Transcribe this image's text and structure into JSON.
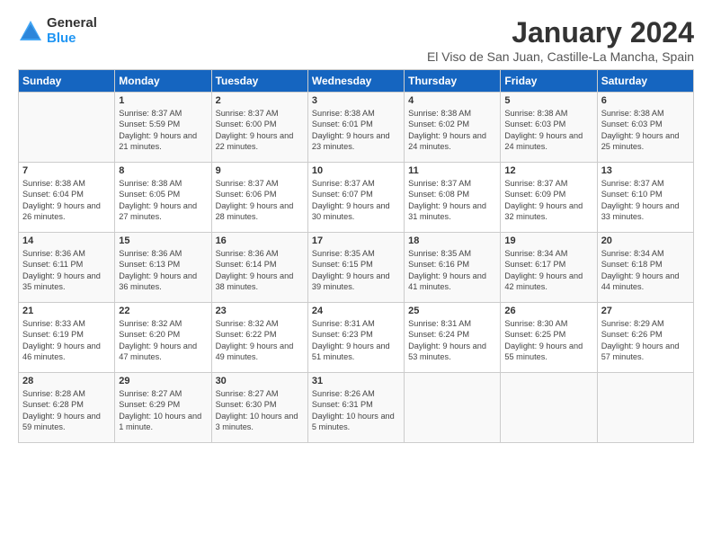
{
  "logo": {
    "general": "General",
    "blue": "Blue"
  },
  "title": "January 2024",
  "location": "El Viso de San Juan, Castille-La Mancha, Spain",
  "headers": [
    "Sunday",
    "Monday",
    "Tuesday",
    "Wednesday",
    "Thursday",
    "Friday",
    "Saturday"
  ],
  "weeks": [
    [
      {
        "day": "",
        "content": ""
      },
      {
        "day": "1",
        "content": "Sunrise: 8:37 AM\nSunset: 5:59 PM\nDaylight: 9 hours\nand 21 minutes."
      },
      {
        "day": "2",
        "content": "Sunrise: 8:37 AM\nSunset: 6:00 PM\nDaylight: 9 hours\nand 22 minutes."
      },
      {
        "day": "3",
        "content": "Sunrise: 8:38 AM\nSunset: 6:01 PM\nDaylight: 9 hours\nand 23 minutes."
      },
      {
        "day": "4",
        "content": "Sunrise: 8:38 AM\nSunset: 6:02 PM\nDaylight: 9 hours\nand 24 minutes."
      },
      {
        "day": "5",
        "content": "Sunrise: 8:38 AM\nSunset: 6:03 PM\nDaylight: 9 hours\nand 24 minutes."
      },
      {
        "day": "6",
        "content": "Sunrise: 8:38 AM\nSunset: 6:03 PM\nDaylight: 9 hours\nand 25 minutes."
      }
    ],
    [
      {
        "day": "7",
        "content": "Sunrise: 8:38 AM\nSunset: 6:04 PM\nDaylight: 9 hours\nand 26 minutes."
      },
      {
        "day": "8",
        "content": "Sunrise: 8:38 AM\nSunset: 6:05 PM\nDaylight: 9 hours\nand 27 minutes."
      },
      {
        "day": "9",
        "content": "Sunrise: 8:37 AM\nSunset: 6:06 PM\nDaylight: 9 hours\nand 28 minutes."
      },
      {
        "day": "10",
        "content": "Sunrise: 8:37 AM\nSunset: 6:07 PM\nDaylight: 9 hours\nand 30 minutes."
      },
      {
        "day": "11",
        "content": "Sunrise: 8:37 AM\nSunset: 6:08 PM\nDaylight: 9 hours\nand 31 minutes."
      },
      {
        "day": "12",
        "content": "Sunrise: 8:37 AM\nSunset: 6:09 PM\nDaylight: 9 hours\nand 32 minutes."
      },
      {
        "day": "13",
        "content": "Sunrise: 8:37 AM\nSunset: 6:10 PM\nDaylight: 9 hours\nand 33 minutes."
      }
    ],
    [
      {
        "day": "14",
        "content": "Sunrise: 8:36 AM\nSunset: 6:11 PM\nDaylight: 9 hours\nand 35 minutes."
      },
      {
        "day": "15",
        "content": "Sunrise: 8:36 AM\nSunset: 6:13 PM\nDaylight: 9 hours\nand 36 minutes."
      },
      {
        "day": "16",
        "content": "Sunrise: 8:36 AM\nSunset: 6:14 PM\nDaylight: 9 hours\nand 38 minutes."
      },
      {
        "day": "17",
        "content": "Sunrise: 8:35 AM\nSunset: 6:15 PM\nDaylight: 9 hours\nand 39 minutes."
      },
      {
        "day": "18",
        "content": "Sunrise: 8:35 AM\nSunset: 6:16 PM\nDaylight: 9 hours\nand 41 minutes."
      },
      {
        "day": "19",
        "content": "Sunrise: 8:34 AM\nSunset: 6:17 PM\nDaylight: 9 hours\nand 42 minutes."
      },
      {
        "day": "20",
        "content": "Sunrise: 8:34 AM\nSunset: 6:18 PM\nDaylight: 9 hours\nand 44 minutes."
      }
    ],
    [
      {
        "day": "21",
        "content": "Sunrise: 8:33 AM\nSunset: 6:19 PM\nDaylight: 9 hours\nand 46 minutes."
      },
      {
        "day": "22",
        "content": "Sunrise: 8:32 AM\nSunset: 6:20 PM\nDaylight: 9 hours\nand 47 minutes."
      },
      {
        "day": "23",
        "content": "Sunrise: 8:32 AM\nSunset: 6:22 PM\nDaylight: 9 hours\nand 49 minutes."
      },
      {
        "day": "24",
        "content": "Sunrise: 8:31 AM\nSunset: 6:23 PM\nDaylight: 9 hours\nand 51 minutes."
      },
      {
        "day": "25",
        "content": "Sunrise: 8:31 AM\nSunset: 6:24 PM\nDaylight: 9 hours\nand 53 minutes."
      },
      {
        "day": "26",
        "content": "Sunrise: 8:30 AM\nSunset: 6:25 PM\nDaylight: 9 hours\nand 55 minutes."
      },
      {
        "day": "27",
        "content": "Sunrise: 8:29 AM\nSunset: 6:26 PM\nDaylight: 9 hours\nand 57 minutes."
      }
    ],
    [
      {
        "day": "28",
        "content": "Sunrise: 8:28 AM\nSunset: 6:28 PM\nDaylight: 9 hours\nand 59 minutes."
      },
      {
        "day": "29",
        "content": "Sunrise: 8:27 AM\nSunset: 6:29 PM\nDaylight: 10 hours\nand 1 minute."
      },
      {
        "day": "30",
        "content": "Sunrise: 8:27 AM\nSunset: 6:30 PM\nDaylight: 10 hours\nand 3 minutes."
      },
      {
        "day": "31",
        "content": "Sunrise: 8:26 AM\nSunset: 6:31 PM\nDaylight: 10 hours\nand 5 minutes."
      },
      {
        "day": "",
        "content": ""
      },
      {
        "day": "",
        "content": ""
      },
      {
        "day": "",
        "content": ""
      }
    ]
  ]
}
